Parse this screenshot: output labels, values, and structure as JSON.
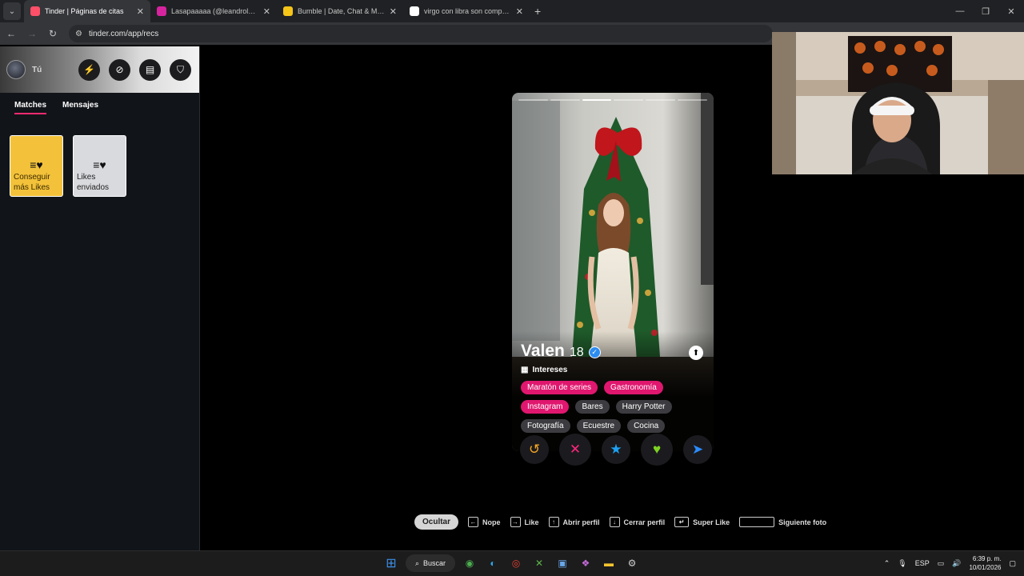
{
  "browser": {
    "tabs": [
      {
        "title": "Tinder | Páginas de citas",
        "favicon": "tinder-icon",
        "color": "#fd5068",
        "active": true
      },
      {
        "title": "Lasapaaaaa (@leandroloaizam)",
        "favicon": "instagram-icon",
        "color": "#d6249f",
        "active": false
      },
      {
        "title": "Bumble | Date, Chat & Meet New",
        "favicon": "bumble-icon",
        "color": "#f5c518",
        "active": false
      },
      {
        "title": "virgo con libra son compatibles",
        "favicon": "google-icon",
        "color": "#ffffff",
        "active": false
      }
    ],
    "new_tab": "+",
    "url": "tinder.com/app/recs"
  },
  "sidebar": {
    "user_label": "Tú",
    "tabs": [
      "Matches",
      "Mensajes"
    ],
    "cards": [
      {
        "label": "Conseguir más Likes",
        "style": "gold"
      },
      {
        "label": "Likes enviados",
        "style": "gray"
      }
    ]
  },
  "profile": {
    "name": "Valen",
    "age": "18",
    "verified": true,
    "photo_count": 6,
    "current_photo": 3,
    "interests_label": "Intereses",
    "interests": [
      {
        "label": "Maratón de series",
        "highlight": true
      },
      {
        "label": "Gastronomía",
        "highlight": true
      },
      {
        "label": "Instagram",
        "highlight": true
      },
      {
        "label": "Bares",
        "highlight": false
      },
      {
        "label": "Harry Potter",
        "highlight": false
      },
      {
        "label": "Fotografía",
        "highlight": false
      },
      {
        "label": "Ecuestre",
        "highlight": false
      },
      {
        "label": "Cocina",
        "highlight": false
      }
    ]
  },
  "actions": [
    {
      "name": "rewind-button",
      "icon": "rewind-icon",
      "glyph": "↺",
      "color": "#f5a623"
    },
    {
      "name": "nope-button",
      "icon": "x-icon",
      "glyph": "✕",
      "color": "#fd267d"
    },
    {
      "name": "super-like-button",
      "icon": "star-icon",
      "glyph": "★",
      "color": "#1da1f2"
    },
    {
      "name": "like-button",
      "icon": "heart-icon",
      "glyph": "♥",
      "color": "#7ed321"
    },
    {
      "name": "boost-button",
      "icon": "send-icon",
      "glyph": "➤",
      "color": "#2a8cff"
    }
  ],
  "shortcuts": {
    "hide": "Ocultar",
    "items": [
      {
        "key": "←",
        "label": "Nope"
      },
      {
        "key": "→",
        "label": "Like"
      },
      {
        "key": "↑",
        "label": "Abrir perfil"
      },
      {
        "key": "↓",
        "label": "Cerrar perfil"
      },
      {
        "key": "↵",
        "label": "Super Like"
      },
      {
        "key": "",
        "label": "Siguiente foto"
      }
    ]
  },
  "taskbar": {
    "search_label": "Buscar",
    "lang": "ESP",
    "time": "6:39 p. m.",
    "date": "10/01/2026"
  }
}
